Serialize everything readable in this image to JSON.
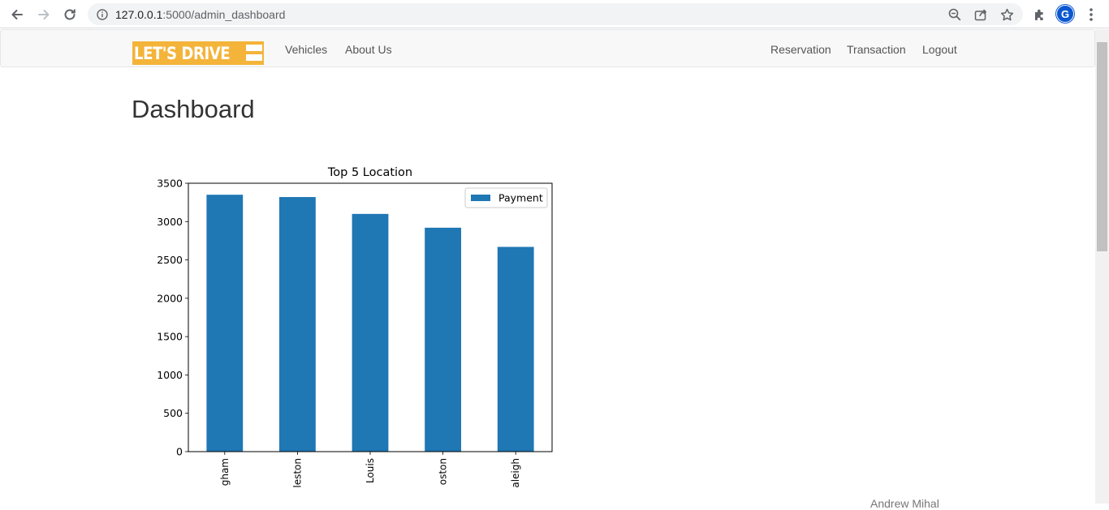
{
  "browser": {
    "url_host": "127.0.0.1",
    "url_rest": ":5000/admin_dashboard",
    "profile_initial": "G"
  },
  "navbar": {
    "brand": "LET'S DRIVE",
    "links_left": [
      "Vehicles",
      "About Us"
    ],
    "links_right": [
      "Reservation",
      "Transaction",
      "Logout"
    ]
  },
  "page": {
    "title": "Dashboard",
    "footer_fragment": "Andrew Mihal"
  },
  "chart_data": {
    "type": "bar",
    "title": "Top 5 Location",
    "categories": [
      "gham",
      "leston",
      "Louis",
      "oston",
      "aleigh"
    ],
    "series": [
      {
        "name": "Payment",
        "values": [
          3350,
          3320,
          3100,
          2920,
          2670
        ],
        "color": "#1f77b4"
      }
    ],
    "ylim": [
      0,
      3500
    ],
    "yticks": [
      0,
      500,
      1000,
      1500,
      2000,
      2500,
      3000,
      3500
    ],
    "legend": "top-right",
    "grid": false,
    "xlabel": "",
    "ylabel": ""
  }
}
